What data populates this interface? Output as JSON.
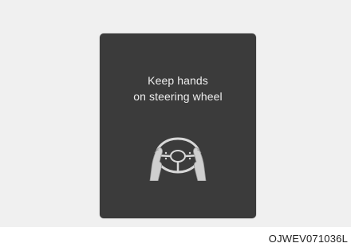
{
  "display": {
    "message_line1": "Keep hands",
    "message_line2": "on steering wheel",
    "icon": "hands-on-steering-wheel-icon",
    "background_color": "#3b3b3b",
    "text_color": "#ededed"
  },
  "figure": {
    "code": "OJWEV071036L"
  }
}
